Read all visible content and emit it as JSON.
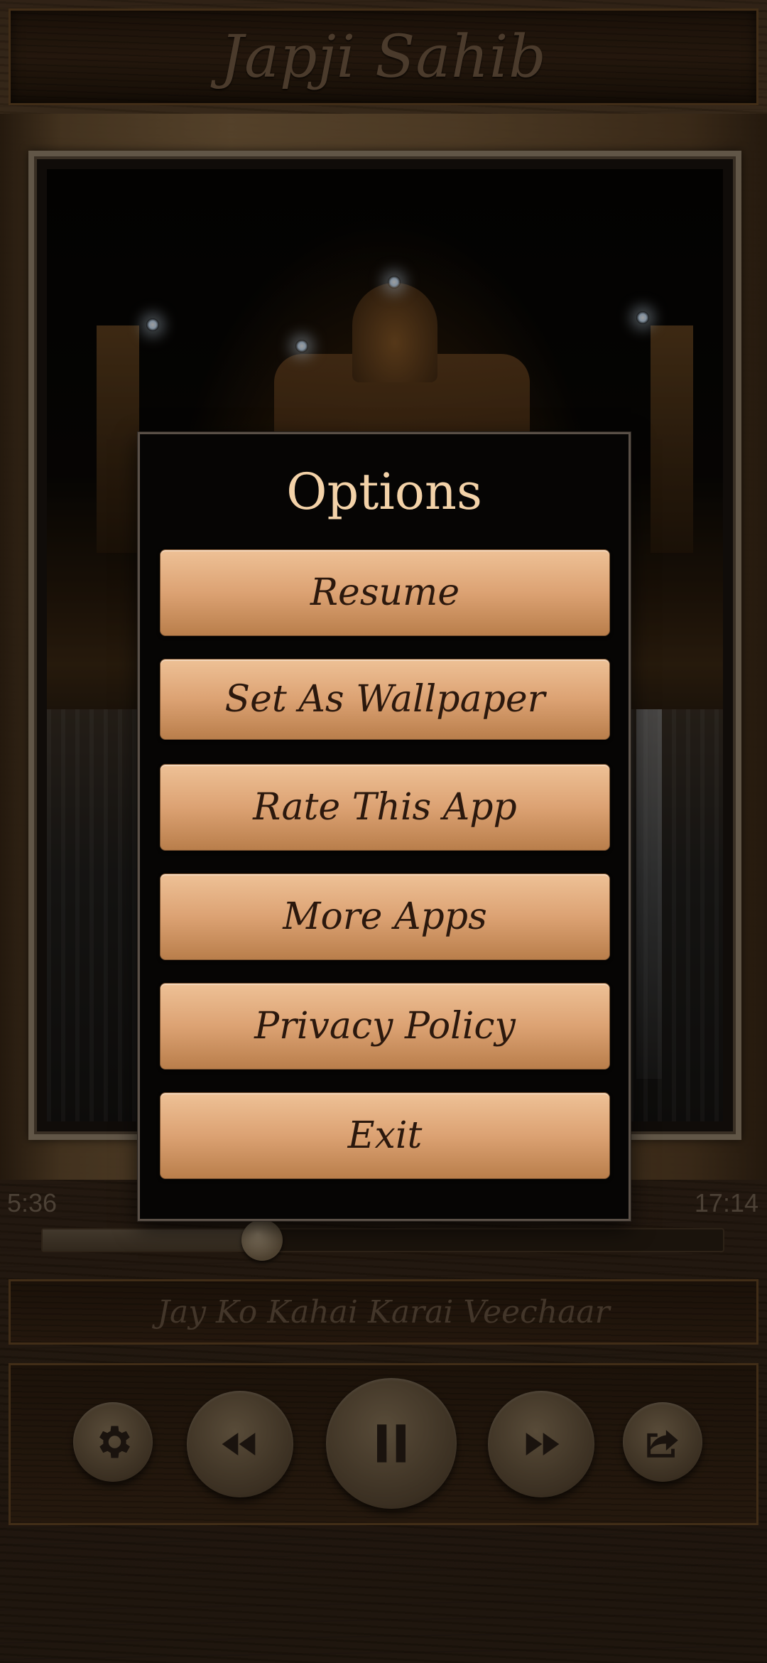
{
  "header": {
    "title": "Japji Sahib"
  },
  "player": {
    "elapsed": "5:36",
    "duration": "17:14",
    "progress": 0.323,
    "track_title": "Jay Ko Kahai Karai Veechaar",
    "controls": {
      "settings_icon": "gear-icon",
      "rewind_icon": "rewind-icon",
      "play_pause_icon": "pause-icon",
      "forward_icon": "fast-forward-icon",
      "share_icon": "share-icon"
    }
  },
  "modal": {
    "title": "Options",
    "options": [
      {
        "label": "Resume"
      },
      {
        "label": "Set As Wallpaper"
      },
      {
        "label": "Rate This App"
      },
      {
        "label": "More Apps"
      },
      {
        "label": "Privacy Policy"
      },
      {
        "label": "Exit"
      }
    ]
  },
  "colors": {
    "option_button": "#dca273",
    "modal_title": "#f3d2a8",
    "modal_background": "#060504"
  }
}
